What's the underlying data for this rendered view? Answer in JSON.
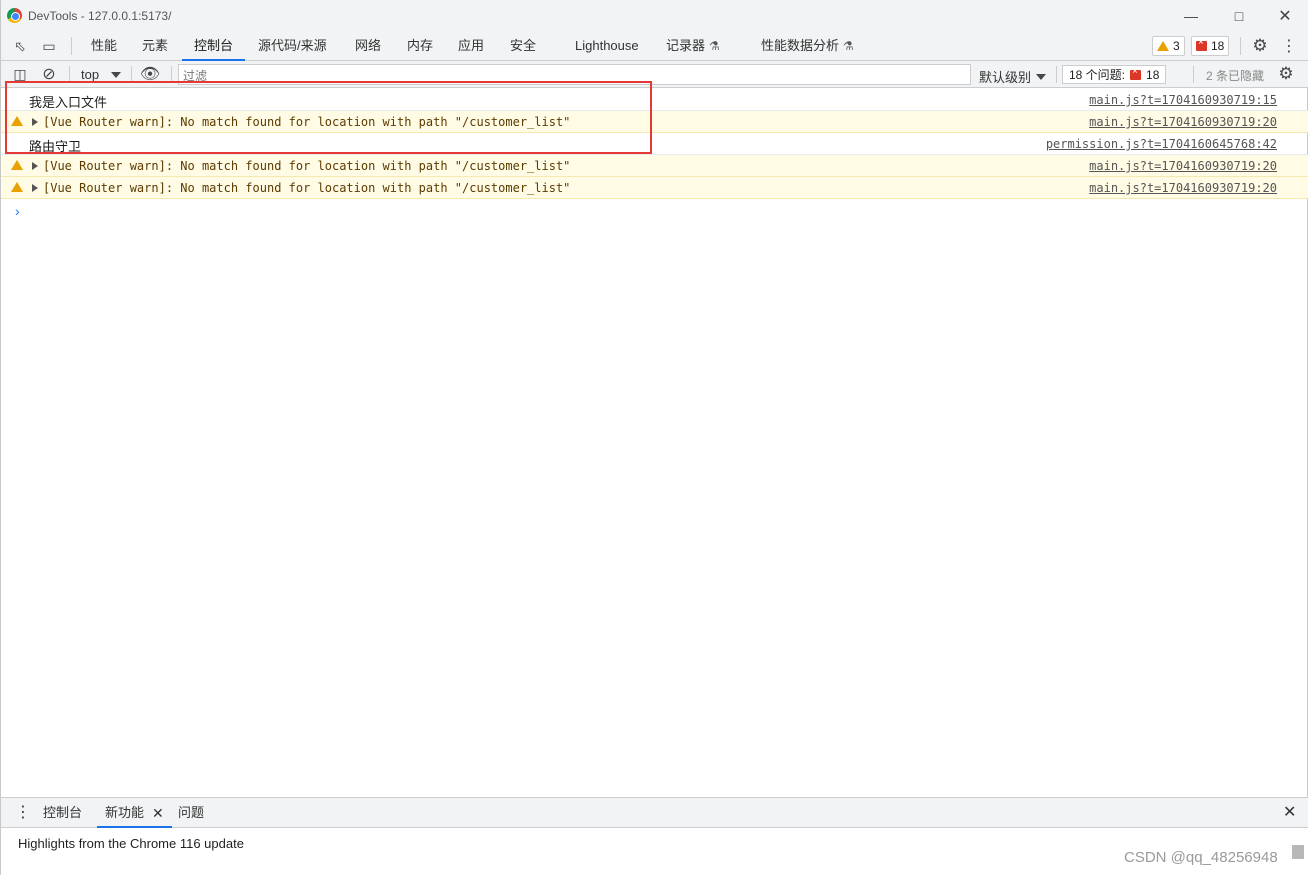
{
  "window": {
    "title": "DevTools - 127.0.0.1:5173/",
    "minimize_icon": "minimize-icon",
    "maximize_icon": "maximize-icon",
    "close_icon": "close-icon"
  },
  "panel_tabs": [
    {
      "label": "性能"
    },
    {
      "label": "元素"
    },
    {
      "label": "控制台",
      "active": true
    },
    {
      "label": "源代码/来源"
    },
    {
      "label": "网络"
    },
    {
      "label": "内存"
    },
    {
      "label": "应用"
    },
    {
      "label": "安全"
    },
    {
      "label": "Lighthouse"
    },
    {
      "label": "记录器"
    },
    {
      "label": "性能数据分析"
    }
  ],
  "status_badges": {
    "warnings": "3",
    "errors": "18"
  },
  "toolbar": {
    "context": "top",
    "filter_placeholder": "过滤",
    "levels": "默认级别",
    "issues_label": "18 个问题:",
    "issues_count": "18",
    "hidden_count": "2 条已隐藏"
  },
  "console_rows": [
    {
      "type": "info",
      "message": "我是入口文件",
      "source": "main.js?t=1704160930719:15"
    },
    {
      "type": "warn",
      "message": "[Vue Router warn]: No match found for location with path \"/customer_list\"",
      "source": "main.js?t=1704160930719:20"
    },
    {
      "type": "info",
      "message": "路由守卫",
      "source": "permission.js?t=1704160645768:42"
    },
    {
      "type": "warn",
      "message": "[Vue Router warn]: No match found for location with path \"/customer_list\"",
      "source": "main.js?t=1704160930719:20"
    },
    {
      "type": "warn",
      "message": "[Vue Router warn]: No match found for location with path \"/customer_list\"",
      "source": "main.js?t=1704160930719:20"
    }
  ],
  "prompt_symbol": "›",
  "drawer": {
    "tabs": [
      {
        "label": "控制台"
      },
      {
        "label": "新功能",
        "active": true
      },
      {
        "label": "问题"
      }
    ],
    "whats_new": "Highlights from the Chrome 116 update",
    "watermark": "CSDN @qq_48256948"
  },
  "colors": {
    "accent": "#1a73e8",
    "warning": "#e8a100",
    "error": "#dc3626",
    "highlight_box": "#e53935"
  }
}
